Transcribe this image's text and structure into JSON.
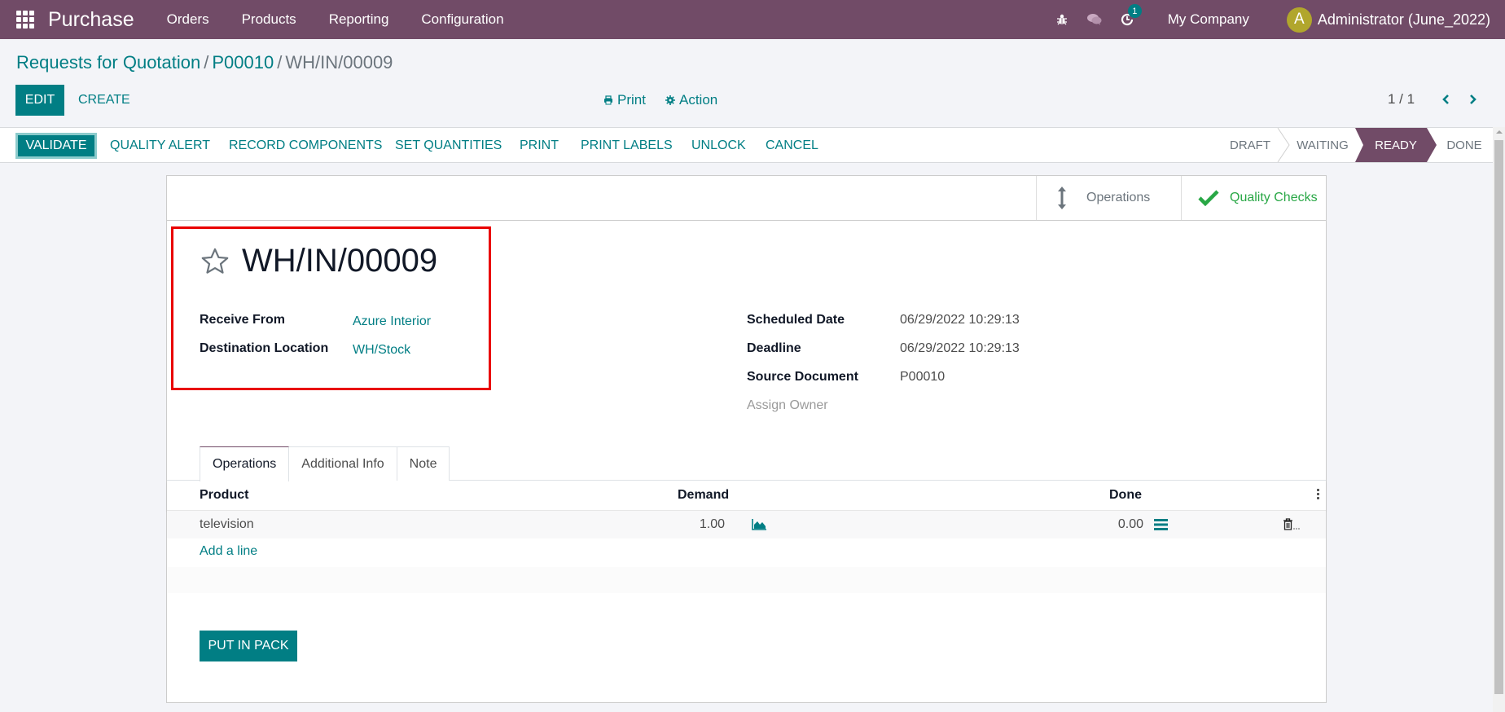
{
  "navbar": {
    "app_name": "Purchase",
    "menu": [
      "Orders",
      "Products",
      "Reporting",
      "Configuration"
    ],
    "activity_badge": "1",
    "company": "My Company",
    "avatar_initial": "A",
    "user": "Administrator (June_2022)"
  },
  "breadcrumb": {
    "items": [
      "Requests for Quotation",
      "P00010"
    ],
    "separator": "/",
    "current": "WH/IN/00009"
  },
  "control": {
    "edit": "EDIT",
    "create": "CREATE",
    "print": "Print",
    "action": "Action",
    "pager": "1 / 1"
  },
  "statusbar": {
    "buttons": [
      "VALIDATE",
      "QUALITY ALERT",
      "RECORD COMPONENTS",
      "SET QUANTITIES",
      "PRINT",
      "PRINT LABELS",
      "UNLOCK",
      "CANCEL"
    ],
    "stages": [
      "DRAFT",
      "WAITING",
      "READY",
      "DONE"
    ],
    "active_stage": "READY"
  },
  "smart_buttons": {
    "operations": "Operations",
    "quality_checks": "Quality Checks"
  },
  "record": {
    "title": "WH/IN/00009",
    "left_fields": [
      {
        "label": "Receive From",
        "value": "Azure Interior"
      },
      {
        "label": "Destination Location",
        "value": "WH/Stock"
      }
    ],
    "right_fields": [
      {
        "label": "Scheduled Date",
        "value": "06/29/2022 10:29:13"
      },
      {
        "label": "Deadline",
        "value": "06/29/2022 10:29:13"
      },
      {
        "label": "Source Document",
        "value": "P00010"
      }
    ],
    "assign_owner": "Assign Owner"
  },
  "tabs": [
    "Operations",
    "Additional Info",
    "Note"
  ],
  "table": {
    "headers": {
      "product": "Product",
      "demand": "Demand",
      "done": "Done"
    },
    "rows": [
      {
        "product": "television",
        "demand": "1.00",
        "done": "0.00"
      }
    ],
    "add_line": "Add a line"
  },
  "footer": {
    "put_in_pack": "PUT IN PACK"
  },
  "colors": {
    "brand": "#714b67",
    "primary": "#017e84",
    "success": "#28a745",
    "highlight": "#e90000"
  }
}
